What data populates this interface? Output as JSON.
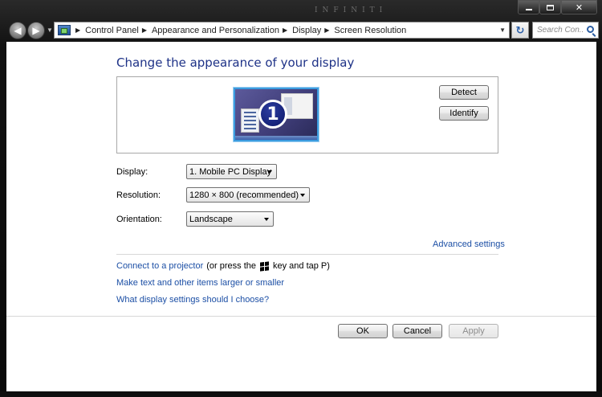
{
  "titlebar": {
    "wallpaper_text": "INFINITI",
    "minimize_label": "",
    "maximize_label": "",
    "close_label": "✕"
  },
  "nav": {
    "back_glyph": "◀",
    "forward_glyph": "▶",
    "breadcrumbs": [
      "Control Panel",
      "Appearance and Personalization",
      "Display",
      "Screen Resolution"
    ],
    "refresh_glyph": "↻",
    "search_placeholder": "Search Con..."
  },
  "page": {
    "title": "Change the appearance of your display",
    "monitor_number": "1",
    "detect_label": "Detect",
    "identify_label": "Identify"
  },
  "settings": {
    "display_label": "Display:",
    "display_value": "1. Mobile PC Display",
    "resolution_label": "Resolution:",
    "resolution_value": "1280 × 800 (recommended)",
    "orientation_label": "Orientation:",
    "orientation_value": "Landscape"
  },
  "links": {
    "advanced": "Advanced settings",
    "projector": "Connect to a projector",
    "projector_suffix_1": "(or press the",
    "projector_suffix_2": "key and tap P)",
    "text_size": "Make text and other items larger or smaller",
    "help": "What display settings should I choose?"
  },
  "footer": {
    "ok_label": "OK",
    "cancel_label": "Cancel",
    "apply_label": "Apply"
  },
  "icons": {
    "address_icon": "control-panel-icon",
    "search_icon": "search-icon",
    "windows_key": "windows-logo-icon"
  }
}
